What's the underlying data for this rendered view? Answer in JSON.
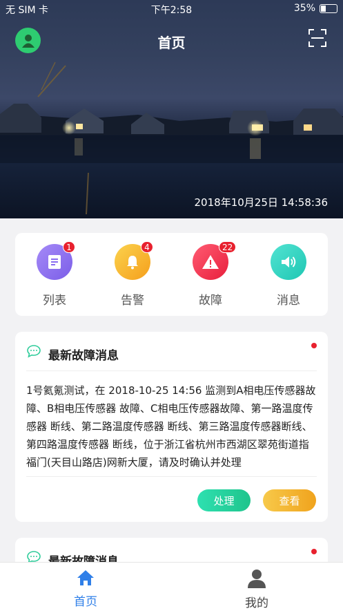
{
  "status_bar": {
    "carrier": "无 SIM 卡",
    "time": "下午2:58",
    "battery": "35%"
  },
  "header": {
    "title": "首页",
    "avatar_icon": "user-avatar-icon",
    "scan_icon": "scan-icon"
  },
  "hero": {
    "datetime": "2018年10月25日  14:58:36"
  },
  "menu": [
    {
      "label": "列表",
      "badge": "1",
      "icon": "list-icon",
      "color": "#8a6cf0"
    },
    {
      "label": "告警",
      "badge": "4",
      "icon": "bell-icon",
      "color": "#f7b731"
    },
    {
      "label": "故障",
      "badge": "22",
      "icon": "warning-icon",
      "color": "#f2344e"
    },
    {
      "label": "消息",
      "badge": "",
      "icon": "speaker-icon",
      "color": "#2fd3c0"
    }
  ],
  "messages": [
    {
      "title": "最新故障消息",
      "body": "1号氦氪测试，在 2018-10-25 14:56 监测到A相电压传感器故障、B相电压传感器 故障、C相电压传感器故障、第一路温度传感器 断线、第二路温度传感器 断线、第三路温度传感器断线、第四路温度传感器 断线，位于浙江省杭州市西湖区翠苑街道指福门(天目山路店)网新大厦，请及时确认并处理",
      "process_label": "处理",
      "view_label": "查看"
    },
    {
      "title": "最新故障消息"
    }
  ],
  "tabbar": [
    {
      "label": "首页",
      "icon": "home-icon",
      "active": true
    },
    {
      "label": "我的",
      "icon": "profile-icon",
      "active": false
    }
  ],
  "colors": {
    "active_tab": "#2f7fe8",
    "inactive_tab": "#444444",
    "process_btn": "#2ed3a0",
    "view_btn": "#f5b22b"
  }
}
